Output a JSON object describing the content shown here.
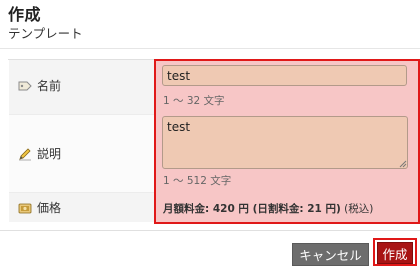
{
  "header": {
    "title": "作成",
    "subtitle": "テンプレート"
  },
  "form": {
    "name": {
      "label": "名前",
      "icon": "tag-icon",
      "value": "test",
      "hint": "1 ～ 32 文字"
    },
    "description": {
      "label": "説明",
      "icon": "pencil-icon",
      "value": "test",
      "hint": "1 ～ 512 文字"
    },
    "price": {
      "label": "価格",
      "icon": "price-icon",
      "monthly_text": "月額料金: 420 円 (日割料金: 21 円)",
      "tax_note": " (税込)"
    }
  },
  "buttons": {
    "cancel_label": "キャンセル",
    "create_label": "作成"
  },
  "colors": {
    "highlight_border": "#e01818",
    "highlight_fill": "#f7c6c6",
    "input_fill": "#efc9b3",
    "cancel_button": "#6d6d6d",
    "create_button": "#a81414"
  }
}
